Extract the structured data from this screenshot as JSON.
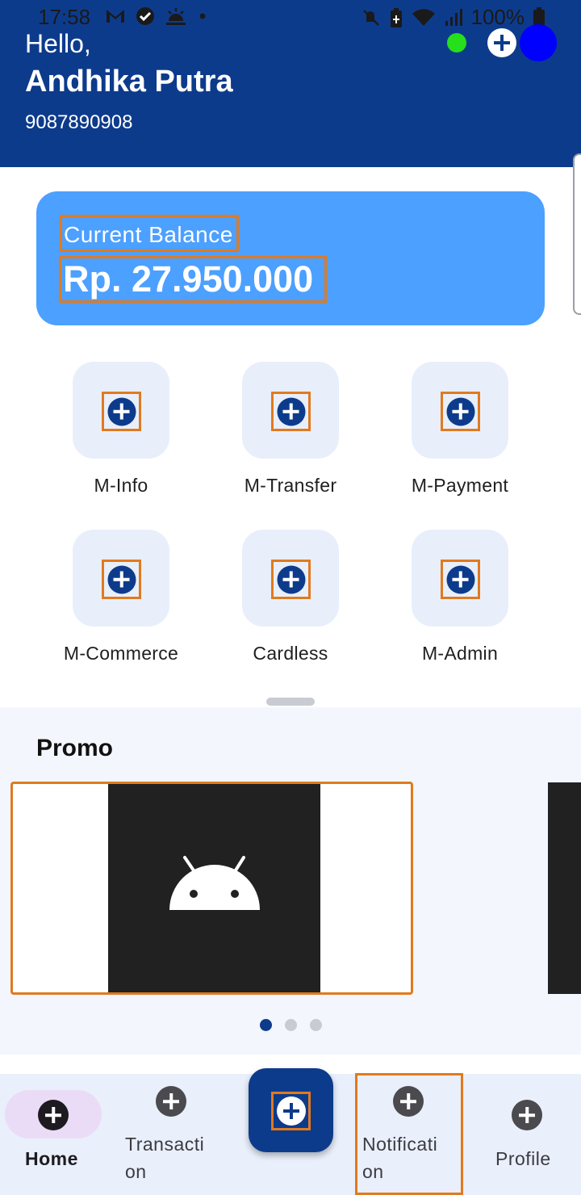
{
  "status_bar": {
    "time": "17:58",
    "battery": "100%",
    "left_icons": [
      "gmail-icon",
      "check-circle-icon",
      "weather-icon",
      "dot-icon"
    ],
    "right_icons": [
      "mute-icon",
      "battery-saver-icon",
      "wifi-icon",
      "signal-icon",
      "battery-icon"
    ]
  },
  "header": {
    "greeting": "Hello,",
    "name": "Andhika Putra",
    "phone": "9087890908",
    "online_color": "#25e01b",
    "avatar_color": "#0000ff",
    "background": "#0d3b8c"
  },
  "balance": {
    "label": "Current Balance",
    "value": "Rp. 27.950.000",
    "card_color": "#4ca0ff"
  },
  "menu": [
    {
      "label": "M-Info",
      "icon": "plus-circle-icon"
    },
    {
      "label": "M-Transfer",
      "icon": "plus-circle-icon"
    },
    {
      "label": "M-Payment",
      "icon": "plus-circle-icon"
    },
    {
      "label": "M-Commerce",
      "icon": "plus-circle-icon"
    },
    {
      "label": "Cardless",
      "icon": "plus-circle-icon"
    },
    {
      "label": "M-Admin",
      "icon": "plus-circle-icon"
    }
  ],
  "promo": {
    "title": "Promo",
    "carousel_pages": 3,
    "active_page": 1,
    "image_icon": "android-icon"
  },
  "bottom_nav": {
    "items": [
      {
        "label": "Home",
        "active": true
      },
      {
        "label_line1": "Transacti",
        "label_line2": "on"
      },
      {
        "label_line1": "Notificati",
        "label_line2": "on"
      },
      {
        "label": "Profile"
      }
    ],
    "fab_icon": "plus-icon"
  },
  "colors": {
    "primary": "#0d3b8c",
    "highlight_border": "#e07a1f",
    "tile_bg": "#e8effb"
  }
}
